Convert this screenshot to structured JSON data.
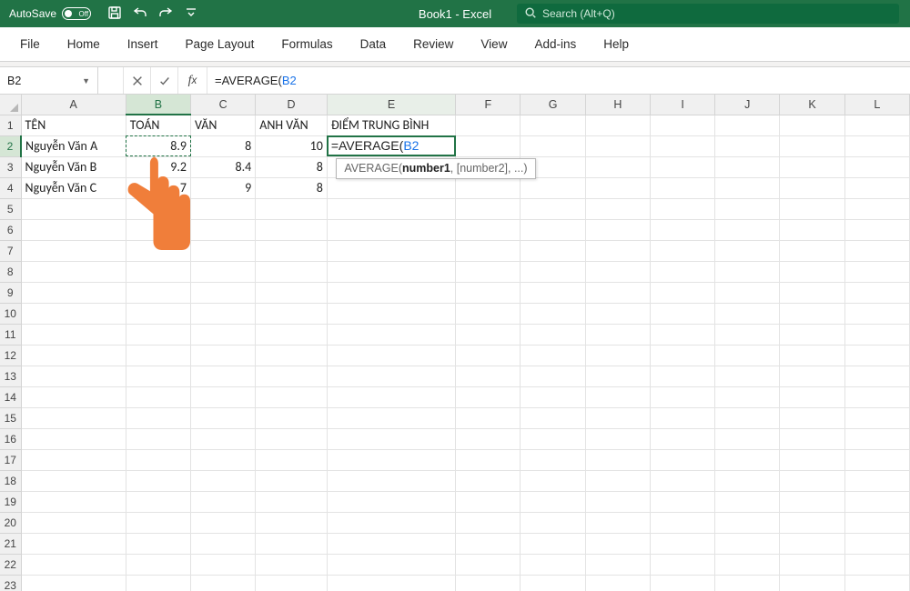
{
  "titlebar": {
    "autosave_label": "AutoSave",
    "autosave_state": "Off",
    "doc_title": "Book1  -  Excel",
    "search_placeholder": "Search (Alt+Q)"
  },
  "ribbon": {
    "tabs": [
      "File",
      "Home",
      "Insert",
      "Page Layout",
      "Formulas",
      "Data",
      "Review",
      "View",
      "Add-ins",
      "Help"
    ]
  },
  "formulabar": {
    "namebox": "B2",
    "formula_prefix": "=AVERAGE(",
    "formula_ref": "B2"
  },
  "columns": [
    "A",
    "B",
    "C",
    "D",
    "E",
    "F",
    "G",
    "H",
    "I",
    "J",
    "K",
    "L"
  ],
  "col_widths": [
    "col-A",
    "col-B",
    "col-C",
    "col-D",
    "col-E",
    "col-def",
    "col-def",
    "col-def",
    "col-def",
    "col-def",
    "col-def",
    "col-def"
  ],
  "active_col_index": 1,
  "edit_col_index": 4,
  "active_row_index": 1,
  "row_count": 23,
  "headers": {
    "A": "TÊN",
    "B": "TOÁN",
    "C": "VĂN",
    "D": "ANH VĂN",
    "E": "ĐIỂM TRUNG BÌNH"
  },
  "rows": [
    {
      "A": "Nguyễn Văn A",
      "B": "8.9",
      "C": "8",
      "D": "10"
    },
    {
      "A": "Nguyễn Văn B",
      "B": "9.2",
      "C": "8.4",
      "D": "8"
    },
    {
      "A": "Nguyễn Văn C",
      "B": "7",
      "C": "9",
      "D": "8"
    }
  ],
  "editing_cell": {
    "prefix": "=AVERAGE(",
    "ref": "B2"
  },
  "tooltip": {
    "func": "AVERAGE(",
    "arg_current": "number1",
    "rest": ", [number2], ...)"
  }
}
